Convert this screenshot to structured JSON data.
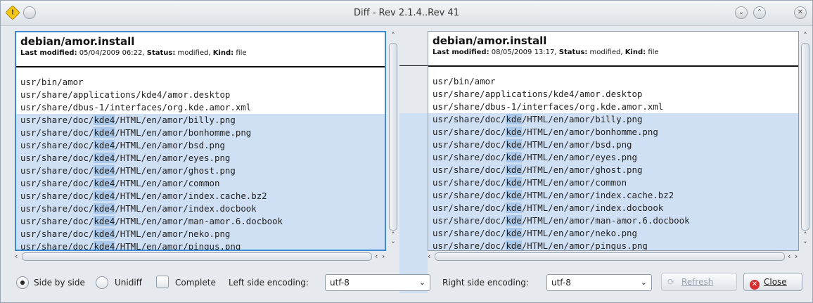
{
  "window": {
    "title": "Diff - Rev 2.1.4..Rev 41"
  },
  "left": {
    "file": "debian/amor.install",
    "last_modified_label": "Last modified:",
    "last_modified": "05/04/2009 06:22,",
    "status_label": "Status:",
    "status": "modified,",
    "kind_label": "Kind:",
    "kind": "file"
  },
  "right": {
    "file": "debian/amor.install",
    "last_modified_label": "Last modified:",
    "last_modified": "08/05/2009 13:17,",
    "status_label": "Status:",
    "status": "modified,",
    "kind_label": "Kind:",
    "kind": "file"
  },
  "left_lines": [
    {
      "pre": "usr/bin/amor",
      "hl": "",
      "post": "",
      "diff": false
    },
    {
      "pre": "usr/share/applications/kde4/amor.desktop",
      "hl": "",
      "post": "",
      "diff": false
    },
    {
      "pre": "usr/share/dbus-1/interfaces/org.kde.amor.xml",
      "hl": "",
      "post": "",
      "diff": false
    },
    {
      "pre": "usr/share/doc/",
      "hl": "kde4",
      "post": "/HTML/en/amor/billy.png",
      "diff": true
    },
    {
      "pre": "usr/share/doc/",
      "hl": "kde4",
      "post": "/HTML/en/amor/bonhomme.png",
      "diff": true
    },
    {
      "pre": "usr/share/doc/",
      "hl": "kde4",
      "post": "/HTML/en/amor/bsd.png",
      "diff": true
    },
    {
      "pre": "usr/share/doc/",
      "hl": "kde4",
      "post": "/HTML/en/amor/eyes.png",
      "diff": true
    },
    {
      "pre": "usr/share/doc/",
      "hl": "kde4",
      "post": "/HTML/en/amor/ghost.png",
      "diff": true
    },
    {
      "pre": "usr/share/doc/",
      "hl": "kde4",
      "post": "/HTML/en/amor/common",
      "diff": true
    },
    {
      "pre": "usr/share/doc/",
      "hl": "kde4",
      "post": "/HTML/en/amor/index.cache.bz2",
      "diff": true
    },
    {
      "pre": "usr/share/doc/",
      "hl": "kde4",
      "post": "/HTML/en/amor/index.docbook",
      "diff": true
    },
    {
      "pre": "usr/share/doc/",
      "hl": "kde4",
      "post": "/HTML/en/amor/man-amor.6.docbook",
      "diff": true
    },
    {
      "pre": "usr/share/doc/",
      "hl": "kde4",
      "post": "/HTML/en/amor/neko.png",
      "diff": true
    },
    {
      "pre": "usr/share/doc/",
      "hl": "kde4",
      "post": "/HTML/en/amor/pingus.png",
      "diff": true
    }
  ],
  "right_lines": [
    {
      "pre": "usr/bin/amor",
      "hl": "",
      "post": "",
      "diff": false
    },
    {
      "pre": "usr/share/applications/kde4/amor.desktop",
      "hl": "",
      "post": "",
      "diff": false
    },
    {
      "pre": "usr/share/dbus-1/interfaces/org.kde.amor.xml",
      "hl": "",
      "post": "",
      "diff": false
    },
    {
      "pre": "usr/share/doc/",
      "hl": "kde",
      "post": "/HTML/en/amor/billy.png",
      "diff": true
    },
    {
      "pre": "usr/share/doc/",
      "hl": "kde",
      "post": "/HTML/en/amor/bonhomme.png",
      "diff": true
    },
    {
      "pre": "usr/share/doc/",
      "hl": "kde",
      "post": "/HTML/en/amor/bsd.png",
      "diff": true
    },
    {
      "pre": "usr/share/doc/",
      "hl": "kde",
      "post": "/HTML/en/amor/eyes.png",
      "diff": true
    },
    {
      "pre": "usr/share/doc/",
      "hl": "kde",
      "post": "/HTML/en/amor/ghost.png",
      "diff": true
    },
    {
      "pre": "usr/share/doc/",
      "hl": "kde",
      "post": "/HTML/en/amor/common",
      "diff": true
    },
    {
      "pre": "usr/share/doc/",
      "hl": "kde",
      "post": "/HTML/en/amor/index.cache.bz2",
      "diff": true
    },
    {
      "pre": "usr/share/doc/",
      "hl": "kde",
      "post": "/HTML/en/amor/index.docbook",
      "diff": true
    },
    {
      "pre": "usr/share/doc/",
      "hl": "kde",
      "post": "/HTML/en/amor/man-amor.6.docbook",
      "diff": true
    },
    {
      "pre": "usr/share/doc/",
      "hl": "kde",
      "post": "/HTML/en/amor/neko.png",
      "diff": true
    },
    {
      "pre": "usr/share/doc/",
      "hl": "kde",
      "post": "/HTML/en/amor/pingus.png",
      "diff": true
    }
  ],
  "options": {
    "side_by_side": "Side by side",
    "unidiff": "Unidiff",
    "complete": "Complete",
    "left_encoding_label": "Left side encoding:",
    "left_encoding": "utf-8",
    "right_encoding_label": "Right side encoding:",
    "right_encoding": "utf-8",
    "refresh": "Refresh",
    "close": "Close"
  },
  "colors": {
    "diff_bg": "#cfe0f4",
    "highlight": "#a9c8ea",
    "focus": "#3c8ad6"
  },
  "icons": [
    "warning-icon",
    "pin-icon",
    "minimize-icon",
    "maximize-icon",
    "window-close-icon",
    "refresh-icon",
    "close-icon"
  ]
}
